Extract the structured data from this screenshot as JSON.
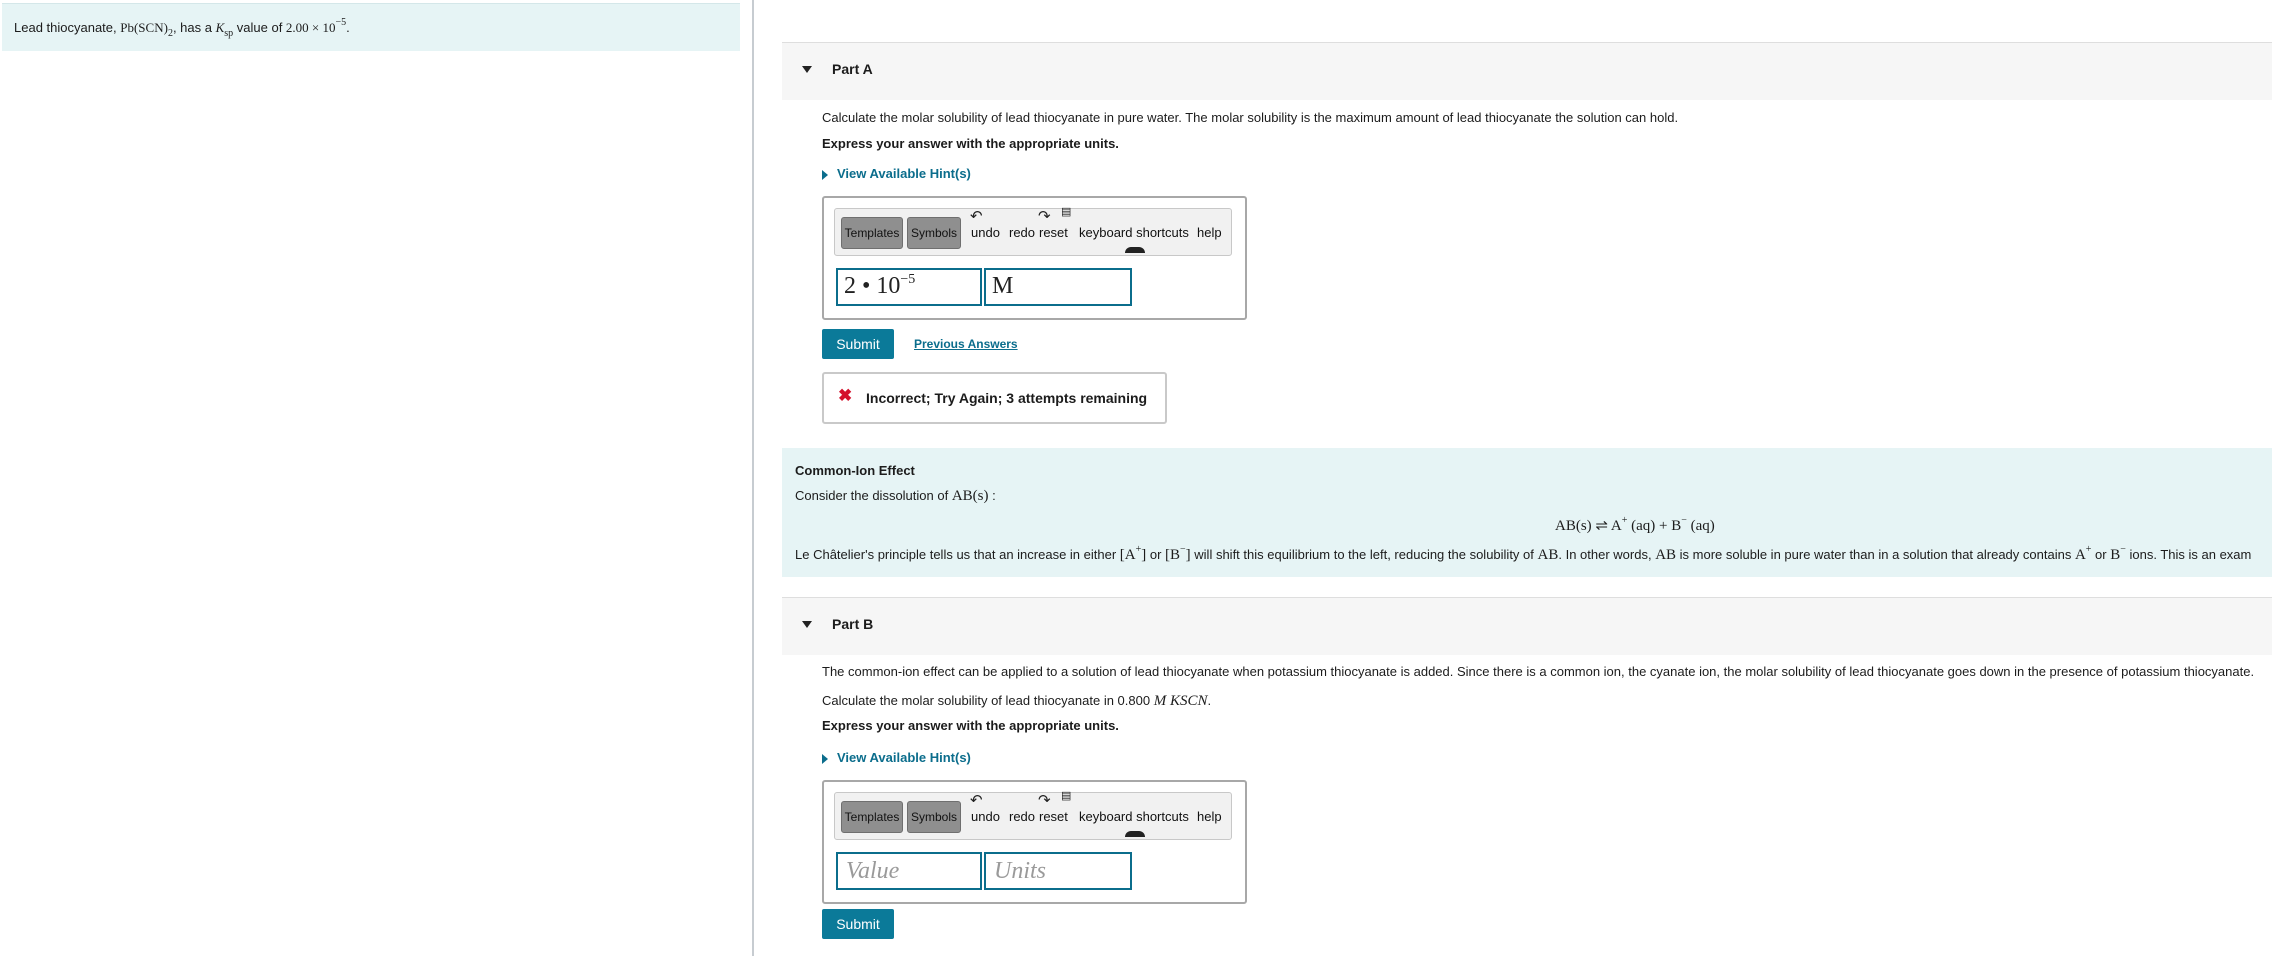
{
  "intro": {
    "prefix": "Lead thiocyanate, ",
    "formula": "Pb(SCN)",
    "formula_sub": "2",
    "middle": ", has a ",
    "ksp_symbol": "K",
    "ksp_sub": "sp",
    "value_text": " value of ",
    "value": "2.00 × 10",
    "value_exp": "−5",
    "suffix": "."
  },
  "part_a": {
    "title": "Part A",
    "question": "Calculate the molar solubility of lead thiocyanate in pure water. The molar solubility is the maximum amount of lead thiocyanate the solution can hold.",
    "instruction": "Express your answer with the appropriate units.",
    "hint_label": "View Available Hint(s)",
    "toolbar": {
      "templates": "Templates",
      "symbols": "Symbols",
      "undo": "undo",
      "redo": "redo",
      "reset": "reset",
      "shortcuts": "keyboard shortcuts",
      "help": "help"
    },
    "value_mantissa": "2 • 10",
    "value_exponent": "−5",
    "units": "M",
    "submit_label": "Submit",
    "previous_answers": "Previous Answers",
    "feedback": "Incorrect; Try Again; 3 attempts remaining",
    "feedback_icon": "✖"
  },
  "common_ion": {
    "title": "Common-Ion Effect",
    "consider_text": "Consider the dissolution of ",
    "consider_math": "AB(s)",
    "consider_suffix": " :",
    "equation": "AB(s) ⇌ A",
    "eq_plus": "+",
    "eq_mid": " (aq) + B",
    "eq_minus": "−",
    "eq_end": " (aq)",
    "body_1": "Le Châtelier's principle tells us that an increase in either ",
    "body_a": "[A",
    "body_a_sup": "+",
    "body_a_close": "]",
    "body_2": " or ",
    "body_b": "[B",
    "body_b_sup": "−",
    "body_b_close": "]",
    "body_3": " will shift this equilibrium to the left, reducing the solubility of ",
    "body_ab1": "AB",
    "body_4": ". In other words, ",
    "body_ab2": "AB",
    "body_5": " is more soluble in pure water than in a solution that already contains ",
    "body_ion_a": "A",
    "body_ion_a_sup": "+",
    "body_6": " or ",
    "body_ion_b": "B",
    "body_ion_b_sup": "−",
    "body_7": " ions. This is an exam"
  },
  "part_b": {
    "title": "Part B",
    "intro": "The common-ion effect can be applied to a solution of lead thiocyanate when potassium thiocyanate is added. Since there is a common ion, the cyanate ion, the molar solubility of lead thiocyanate goes down in the presence of potassium thiocyanate.",
    "question_prefix": "Calculate the molar solubility of lead thiocyanate in 0.800 ",
    "question_math": "M KSCN",
    "question_suffix": ".",
    "instruction": "Express your answer with the appropriate units.",
    "hint_label": "View Available Hint(s)",
    "value_placeholder": "Value",
    "units_placeholder": "Units",
    "submit_label": "Submit"
  },
  "colors": {
    "accent": "#0b7a99",
    "link": "#0b6d8c",
    "info_bg": "#e6f4f5",
    "error": "#d4102b"
  }
}
